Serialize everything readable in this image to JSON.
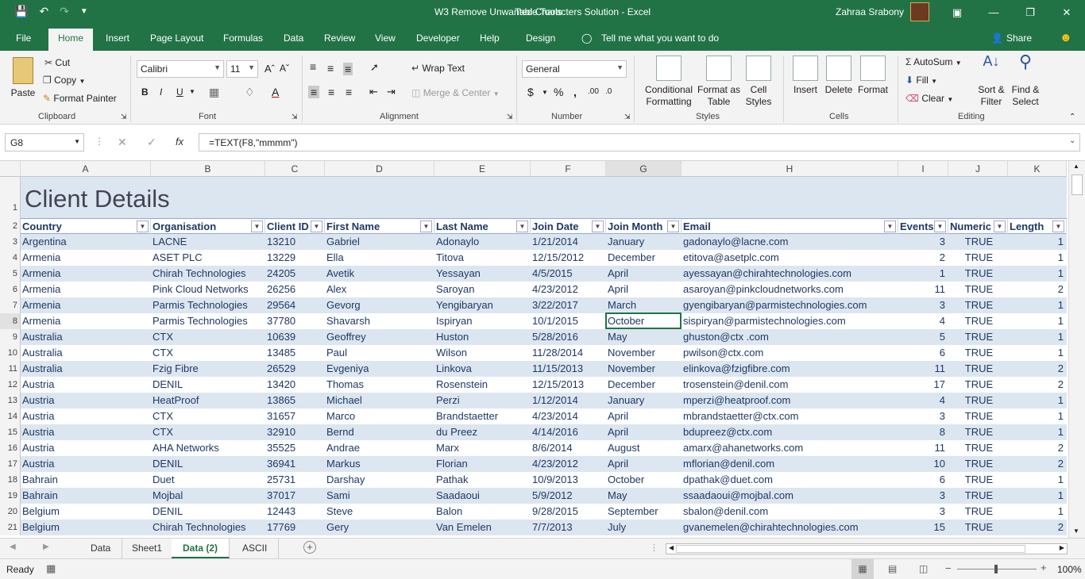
{
  "app": {
    "window_title": "W3 Remove Unwanted Characters Solution  -  Excel",
    "table_tools": "Table Tools",
    "user_name": "Zahraa Srabony"
  },
  "tabs": [
    "File",
    "Home",
    "Insert",
    "Page Layout",
    "Formulas",
    "Data",
    "Review",
    "View",
    "Developer",
    "Help",
    "Design"
  ],
  "tell_me": "Tell me what you want to do",
  "share": "Share",
  "ribbon": {
    "paste": "Paste",
    "cut": "Cut",
    "copy": "Copy",
    "format_painter": "Format Painter",
    "clipboard": "Clipboard",
    "font_name": "Calibri",
    "font_size": "11",
    "font": "Font",
    "wrap_text": "Wrap Text",
    "merge_center": "Merge & Center",
    "alignment": "Alignment",
    "number_format": "General",
    "number": "Number",
    "conditional_formatting": "Conditional Formatting",
    "format_as_table": "Format as Table",
    "cell_styles": "Cell Styles",
    "styles": "Styles",
    "insert": "Insert",
    "delete": "Delete",
    "format": "Format",
    "cells": "Cells",
    "autosum": "AutoSum",
    "fill": "Fill",
    "clear": "Clear",
    "sort_filter": "Sort & Filter",
    "find_select": "Find & Select",
    "editing": "Editing"
  },
  "formula_bar": {
    "name_box": "G8",
    "fx": "fx",
    "formula": "=TEXT(F8,\"mmmm\")"
  },
  "columns": [
    "A",
    "B",
    "C",
    "D",
    "E",
    "F",
    "G",
    "H",
    "I",
    "J",
    "K"
  ],
  "sheet_title": "Client Details",
  "headers": [
    "Country",
    "Organisation",
    "Client ID",
    "First Name",
    "Last Name",
    "Join Date",
    "Join Month",
    "Email",
    "Events",
    "Numeric",
    "Length"
  ],
  "rows": [
    [
      "Argentina",
      "LACNE",
      "13210",
      "Gabriel",
      "Adonaylo",
      "1/21/2014",
      "January",
      "gadonaylo@lacne.com",
      "3",
      "TRUE",
      "1"
    ],
    [
      "Armenia",
      "ASET PLC",
      "13229",
      "Ella",
      "Titova",
      "12/15/2012",
      "December",
      "etitova@asetplc.com",
      "2",
      "TRUE",
      "1"
    ],
    [
      "Armenia",
      "Chirah Technologies",
      "24205",
      "Avetik",
      "Yessayan",
      "4/5/2015",
      "April",
      "ayessayan@chirahtechnologies.com",
      "1",
      "TRUE",
      "1"
    ],
    [
      "Armenia",
      "Pink Cloud Networks",
      "26256",
      "Alex",
      "Saroyan",
      "4/23/2012",
      "April",
      "asaroyan@pinkcloudnetworks.com",
      "11",
      "TRUE",
      "2"
    ],
    [
      "Armenia",
      "Parmis Technologies",
      "29564",
      "Gevorg",
      "Yengibaryan",
      "3/22/2017",
      "March",
      "gyengibaryan@parmistechnologies.com",
      "3",
      "TRUE",
      "1"
    ],
    [
      "Armenia",
      "Parmis Technologies",
      "37780",
      "Shavarsh",
      "Ispiryan",
      "10/1/2015",
      "October",
      "sispiryan@parmistechnologies.com",
      "4",
      "TRUE",
      "1"
    ],
    [
      "Australia",
      "CTX",
      "10639",
      "Geoffrey",
      "Huston",
      "5/28/2016",
      "May",
      "ghuston@ctx .com",
      "5",
      "TRUE",
      "1"
    ],
    [
      "Australia",
      "CTX",
      "13485",
      "Paul",
      "Wilson",
      "11/28/2014",
      "November",
      "pwilson@ctx.com",
      "6",
      "TRUE",
      "1"
    ],
    [
      "Australia",
      "Fzig Fibre",
      "26529",
      "Evgeniya",
      "Linkova",
      "11/15/2013",
      "November",
      "elinkova@fzigfibre.com",
      "11",
      "TRUE",
      "2"
    ],
    [
      "Austria",
      "DENIL",
      "13420",
      "Thomas",
      "Rosenstein",
      "12/15/2013",
      "December",
      "trosenstein@denil.com",
      "17",
      "TRUE",
      "2"
    ],
    [
      "Austria",
      "HeatProof",
      "13865",
      "Michael",
      "Perzi",
      "1/12/2014",
      "January",
      "mperzi@heatproof.com",
      "4",
      "TRUE",
      "1"
    ],
    [
      "Austria",
      "CTX",
      "31657",
      "Marco",
      "Brandstaetter",
      "4/23/2014",
      "April",
      "mbrandstaetter@ctx.com",
      "3",
      "TRUE",
      "1"
    ],
    [
      "Austria",
      "CTX",
      "32910",
      "Bernd",
      "du Preez",
      "4/14/2016",
      "April",
      "bdupreez@ctx.com",
      "8",
      "TRUE",
      "1"
    ],
    [
      "Austria",
      "AHA Networks",
      "35525",
      "Andrae",
      "Marx",
      "8/6/2014",
      "August",
      "amarx@ahanetworks.com",
      "11",
      "TRUE",
      "2"
    ],
    [
      "Austria",
      "DENIL",
      "36941",
      "Markus",
      "Florian",
      "4/23/2012",
      "April",
      "mflorian@denil.com",
      "10",
      "TRUE",
      "2"
    ],
    [
      "Bahrain",
      "Duet",
      "25731",
      "Darshay",
      "Pathak",
      "10/9/2013",
      "October",
      "dpathak@duet.com",
      "6",
      "TRUE",
      "1"
    ],
    [
      "Bahrain",
      "Mojbal",
      "37017",
      "Sami",
      "Saadaoui",
      "5/9/2012",
      "May",
      "ssaadaoui@mojbal.com",
      "3",
      "TRUE",
      "1"
    ],
    [
      "Belgium",
      "DENIL",
      "12443",
      "Steve",
      "Balon",
      "9/28/2015",
      "September",
      "sbalon@denil.com",
      "3",
      "TRUE",
      "1"
    ],
    [
      "Belgium",
      "Chirah Technologies",
      "17769",
      "Gery",
      "Van Emelen",
      "7/7/2013",
      "July",
      "gvanemelen@chirahtechnologies.com",
      "15",
      "TRUE",
      "2"
    ]
  ],
  "sheets": [
    "Data",
    "Sheet1",
    "Data (2)",
    "ASCII"
  ],
  "active_sheet": "Data (2)",
  "status": {
    "ready": "Ready",
    "zoom": "100%"
  },
  "colors": {
    "excel_green": "#217346",
    "band_blue": "#dce6f1",
    "text_blue": "#1f3864"
  }
}
